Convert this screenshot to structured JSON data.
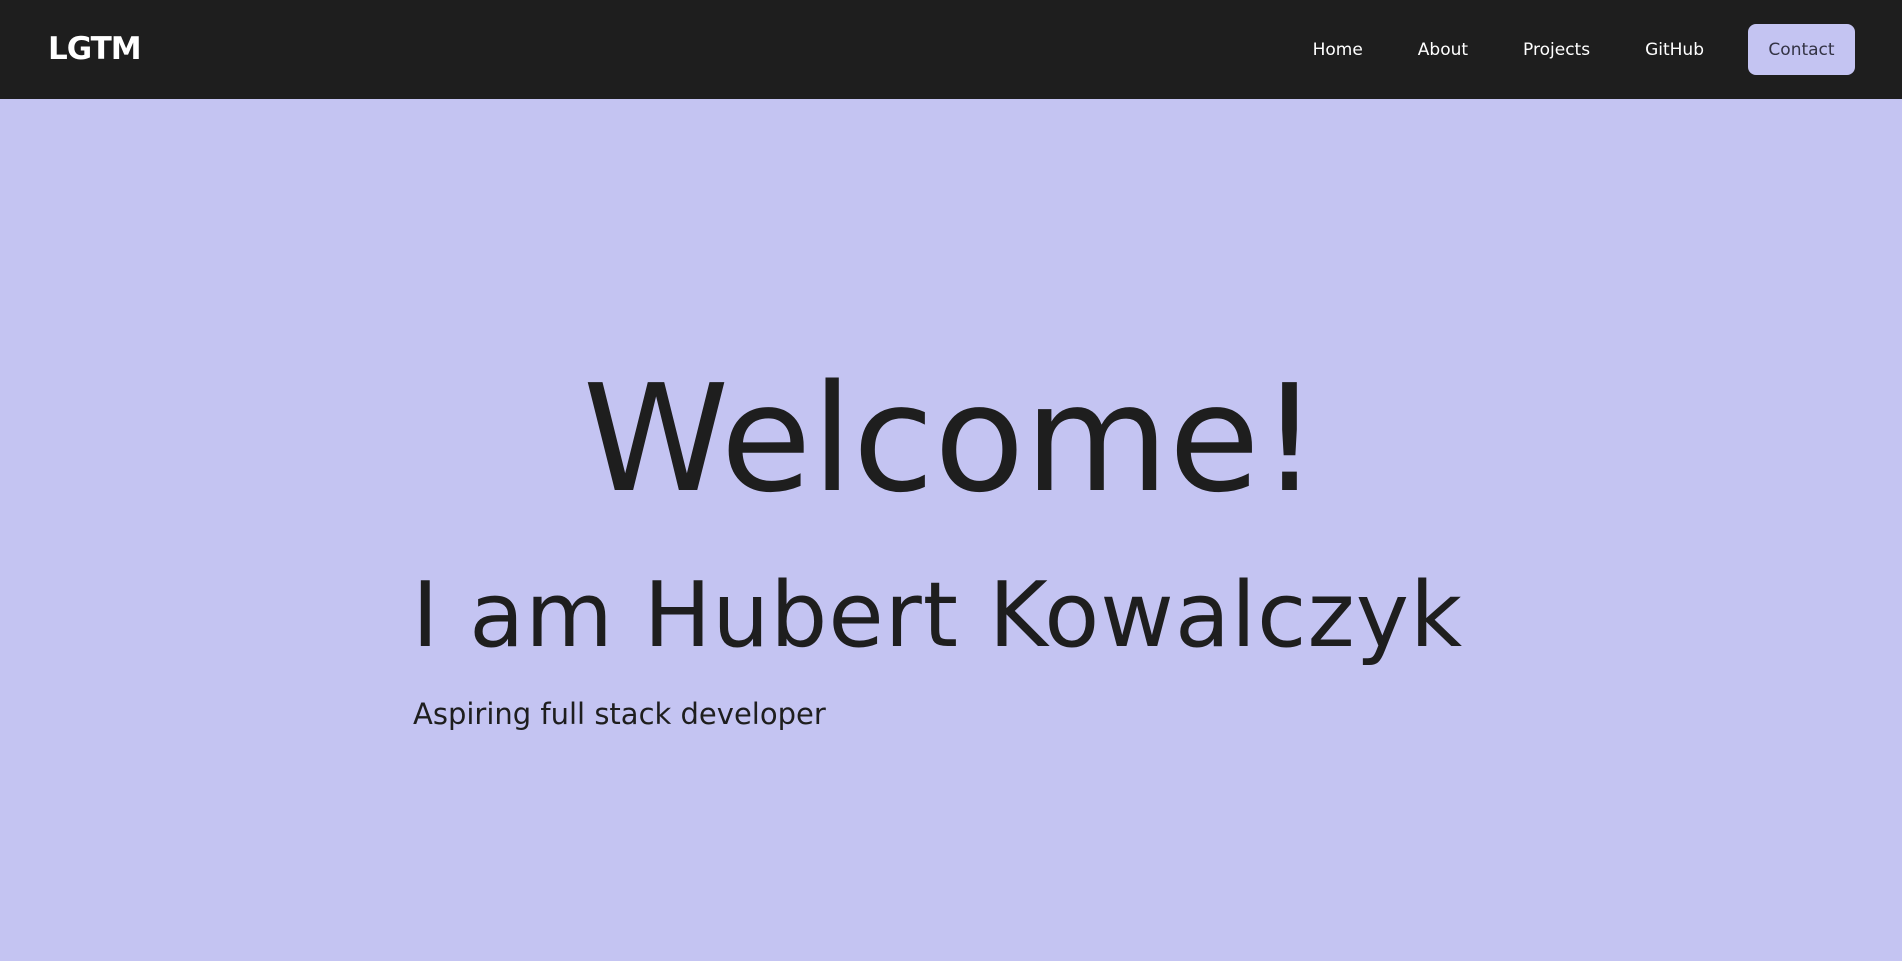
{
  "header": {
    "logo": "LGTM",
    "nav": {
      "home": "Home",
      "about": "About",
      "projects": "Projects",
      "github": "GitHub",
      "contact": "Contact"
    }
  },
  "hero": {
    "title": "Welcome!",
    "name": "I am Hubert Kowalczyk",
    "subtitle": "Aspiring full stack developer"
  },
  "colors": {
    "navbar_bg": "#1e1e1e",
    "accent": "#c4c4f2",
    "text_dark": "#1e1e1e",
    "text_light": "#ffffff"
  }
}
